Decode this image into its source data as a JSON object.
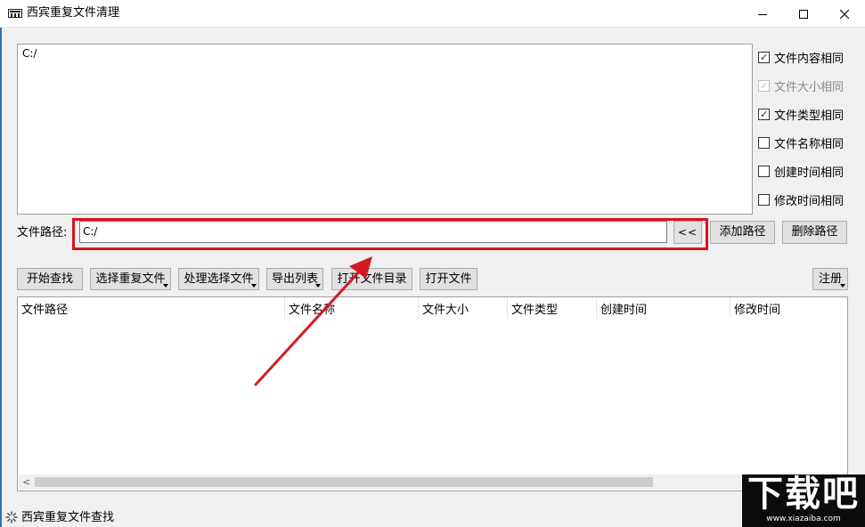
{
  "window": {
    "title": "西宾重复文件清理",
    "controls": [
      "minimize-icon",
      "maximize-icon",
      "close-icon"
    ]
  },
  "path_list": {
    "items": [
      "C:/"
    ]
  },
  "options": [
    {
      "label": "文件内容相同",
      "checked": true,
      "enabled": true
    },
    {
      "label": "文件大小相同",
      "checked": true,
      "enabled": false
    },
    {
      "label": "文件类型相同",
      "checked": true,
      "enabled": true
    },
    {
      "label": "文件名称相同",
      "checked": false,
      "enabled": true
    },
    {
      "label": "创建时间相同",
      "checked": false,
      "enabled": true
    },
    {
      "label": "修改时间相同",
      "checked": false,
      "enabled": true
    }
  ],
  "path_row": {
    "label": "文件路径:",
    "value": "C:/",
    "back_button": "<<",
    "add_button": "添加路径",
    "delete_button": "删除路径"
  },
  "toolbar": {
    "start_search": "开始查找",
    "select_duplicates": "选择重复文件",
    "process_selected": "处理选择文件",
    "export_list": "导出列表",
    "open_directory": "打开文件目录",
    "open_file": "打开文件",
    "register": "注册"
  },
  "table": {
    "columns": [
      "文件路径",
      "文件名称",
      "文件大小",
      "文件类型",
      "创建时间",
      "修改时间"
    ],
    "rows": []
  },
  "status": {
    "text": "西宾重复文件查找"
  },
  "watermark": {
    "main": "下载吧",
    "sub": "www.xiazaiba.com"
  },
  "colors": {
    "highlight": "#e0101c",
    "window_bg": "#f0f0f0",
    "button_bg": "#e1e1e1"
  }
}
